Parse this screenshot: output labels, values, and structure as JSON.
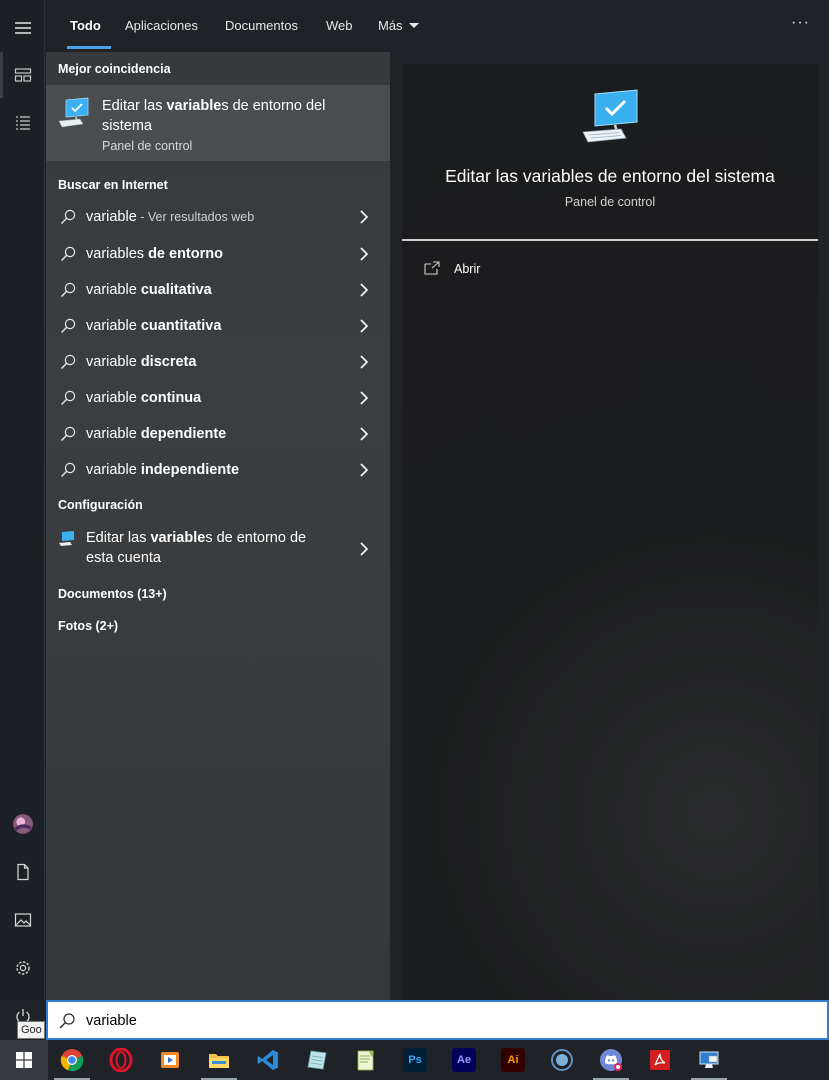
{
  "tabs": [
    {
      "label": "Todo"
    },
    {
      "label": "Aplicaciones"
    },
    {
      "label": "Documentos"
    },
    {
      "label": "Web"
    },
    {
      "label": "Más"
    }
  ],
  "more_menu_icon": "ellipsis-icon",
  "close_icon": "close-icon",
  "results": {
    "best_match_header": "Mejor coincidencia",
    "best_match": {
      "title_pre": "Editar las ",
      "title_bold": "variable",
      "title_post": "s de entorno del sistema",
      "subtitle": "Panel de control"
    },
    "web_header": "Buscar en Internet",
    "web_items": [
      {
        "normal": "variable",
        "bold": "",
        "hint": " - Ver resultados web"
      },
      {
        "normal": "variables ",
        "bold": "de entorno",
        "hint": ""
      },
      {
        "normal": "variable ",
        "bold": "cualitativa",
        "hint": ""
      },
      {
        "normal": "variable ",
        "bold": "cuantitativa",
        "hint": ""
      },
      {
        "normal": "variable ",
        "bold": "discreta",
        "hint": ""
      },
      {
        "normal": "variable ",
        "bold": "continua",
        "hint": ""
      },
      {
        "normal": "variable ",
        "bold": "dependiente",
        "hint": ""
      },
      {
        "normal": "variable ",
        "bold": "independiente",
        "hint": ""
      }
    ],
    "config_header": "Configuración",
    "config_item": {
      "title_pre": "Editar las ",
      "title_bold": "variable",
      "title_post": "s de entorno de esta cuenta"
    },
    "documents_header": "Documentos (13+)",
    "photos_header": "Fotos (2+)"
  },
  "preview": {
    "title": "Editar las variables de entorno del sistema",
    "subtitle": "Panel de control",
    "open_label": "Abrir"
  },
  "search": {
    "value": "variable"
  },
  "tooltip": "Goo",
  "taskbar": {
    "apps": [
      {
        "name": "chrome",
        "label": ""
      },
      {
        "name": "opera",
        "label": ""
      },
      {
        "name": "media-player",
        "label": ""
      },
      {
        "name": "file-explorer",
        "label": ""
      },
      {
        "name": "vscode",
        "label": ""
      },
      {
        "name": "notes-app",
        "label": ""
      },
      {
        "name": "notepad-plus",
        "label": ""
      },
      {
        "name": "photoshop",
        "label": "Ps"
      },
      {
        "name": "after-effects",
        "label": "Ae"
      },
      {
        "name": "illustrator",
        "label": "Ai"
      },
      {
        "name": "circle-app",
        "label": ""
      },
      {
        "name": "discord",
        "label": ""
      },
      {
        "name": "acrobat",
        "label": ""
      },
      {
        "name": "remote-desktop",
        "label": ""
      }
    ]
  },
  "colors": {
    "accent": "#4aa0e6",
    "search_border": "#2d7fd3",
    "best_match_bg": "#4a4d50"
  }
}
